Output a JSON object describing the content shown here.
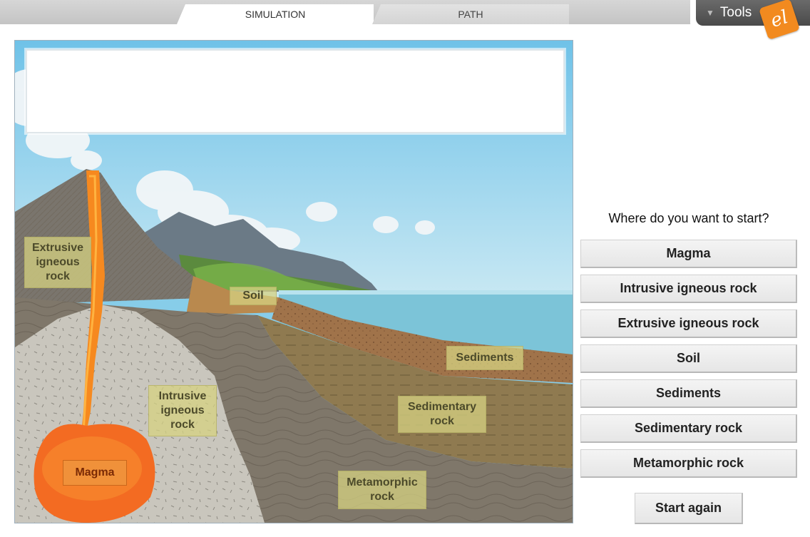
{
  "tabs": [
    {
      "label": "SIMULATION",
      "active": true
    },
    {
      "label": "PATH",
      "active": false
    }
  ],
  "tools": {
    "label": "Tools",
    "icon": "triangle-down-icon",
    "logo_text": "el"
  },
  "scene": {
    "labels": {
      "extrusive": "Extrusive igneous rock",
      "soil": "Soil",
      "sediments": "Sediments",
      "intrusive": "Intrusive igneous rock",
      "sedimentary": "Sedimentary rock",
      "magma": "Magma",
      "metamorphic": "Metamorphic rock"
    },
    "message": ""
  },
  "panel": {
    "prompt": "Where do you want to start?",
    "options": [
      "Magma",
      "Intrusive igneous rock",
      "Extrusive igneous rock",
      "Soil",
      "Sediments",
      "Sedimentary rock",
      "Metamorphic rock"
    ],
    "start_again": "Start again"
  },
  "colors": {
    "accent_orange": "#f28a1f",
    "lava": "#f6891f",
    "sky": "#87cde9",
    "water": "#7cc4d8"
  }
}
